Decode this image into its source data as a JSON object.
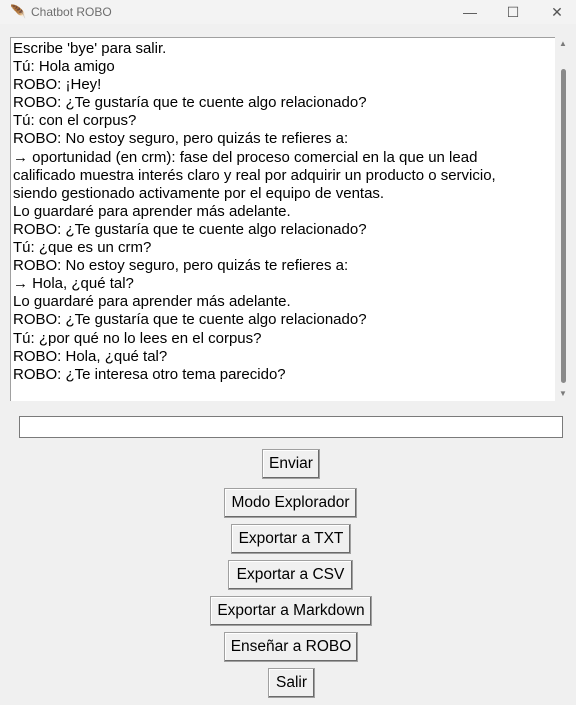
{
  "window": {
    "title": "Chatbot ROBO",
    "app_icon": "feather-icon",
    "minimize_glyph": "—",
    "maximize_glyph": "☐",
    "close_glyph": "✕"
  },
  "chat": {
    "lines": [
      "Escribe 'bye' para salir.",
      "Tú: Hola amigo",
      "ROBO: ¡Hey!",
      "ROBO: ¿Te gustaría que te cuente algo relacionado?",
      "Tú: con el corpus?",
      "ROBO: No estoy seguro, pero quizás te refieres a:",
      "→ oportunidad (en crm): fase del proceso comercial en la que un lead",
      "calificado muestra interés claro y real por adquirir un producto o servicio,",
      "siendo gestionado activamente por el equipo de ventas.",
      "Lo guardaré para aprender más adelante.",
      "ROBO: ¿Te gustaría que te cuente algo relacionado?",
      "Tú: ¿que es un crm?",
      "ROBO: No estoy seguro, pero quizás te refieres a:",
      "→ Hola, ¿qué tal?",
      "Lo guardaré para aprender más adelante.",
      "ROBO: ¿Te gustaría que te cuente algo relacionado?",
      "Tú: ¿por qué no lo lees en el corpus?",
      "ROBO: Hola, ¿qué tal?",
      "ROBO: ¿Te interesa otro tema parecido?"
    ]
  },
  "input": {
    "value": ""
  },
  "buttons": {
    "enviar": "Enviar",
    "modo_explorador": "Modo Explorador",
    "exportar_txt": "Exportar a TXT",
    "exportar_csv": "Exportar a CSV",
    "exportar_md": "Exportar a Markdown",
    "ensenar": "Enseñar a ROBO",
    "salir": "Salir"
  }
}
